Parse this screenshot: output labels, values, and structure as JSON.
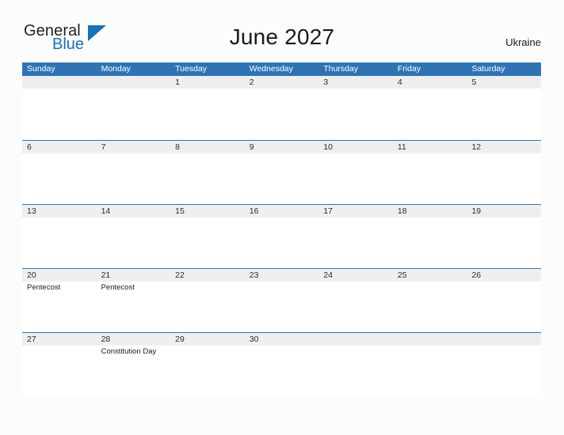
{
  "brand": {
    "name_top": "General",
    "name_bottom": "Blue",
    "accent_color": "#1572bd"
  },
  "header": {
    "title": "June 2027",
    "region": "Ukraine"
  },
  "calendar": {
    "header_color": "#2e74b5",
    "band_color": "#efefef",
    "weekdays": [
      "Sunday",
      "Monday",
      "Tuesday",
      "Wednesday",
      "Thursday",
      "Friday",
      "Saturday"
    ],
    "weeks": [
      [
        {
          "date": "",
          "events": []
        },
        {
          "date": "",
          "events": []
        },
        {
          "date": "1",
          "events": []
        },
        {
          "date": "2",
          "events": []
        },
        {
          "date": "3",
          "events": []
        },
        {
          "date": "4",
          "events": []
        },
        {
          "date": "5",
          "events": []
        }
      ],
      [
        {
          "date": "6",
          "events": []
        },
        {
          "date": "7",
          "events": []
        },
        {
          "date": "8",
          "events": []
        },
        {
          "date": "9",
          "events": []
        },
        {
          "date": "10",
          "events": []
        },
        {
          "date": "11",
          "events": []
        },
        {
          "date": "12",
          "events": []
        }
      ],
      [
        {
          "date": "13",
          "events": []
        },
        {
          "date": "14",
          "events": []
        },
        {
          "date": "15",
          "events": []
        },
        {
          "date": "16",
          "events": []
        },
        {
          "date": "17",
          "events": []
        },
        {
          "date": "18",
          "events": []
        },
        {
          "date": "19",
          "events": []
        }
      ],
      [
        {
          "date": "20",
          "events": [
            "Pentecost"
          ]
        },
        {
          "date": "21",
          "events": [
            "Pentecost"
          ]
        },
        {
          "date": "22",
          "events": []
        },
        {
          "date": "23",
          "events": []
        },
        {
          "date": "24",
          "events": []
        },
        {
          "date": "25",
          "events": []
        },
        {
          "date": "26",
          "events": []
        }
      ],
      [
        {
          "date": "27",
          "events": []
        },
        {
          "date": "28",
          "events": [
            "Constitution Day"
          ]
        },
        {
          "date": "29",
          "events": []
        },
        {
          "date": "30",
          "events": []
        },
        {
          "date": "",
          "events": []
        },
        {
          "date": "",
          "events": []
        },
        {
          "date": "",
          "events": []
        }
      ]
    ]
  }
}
